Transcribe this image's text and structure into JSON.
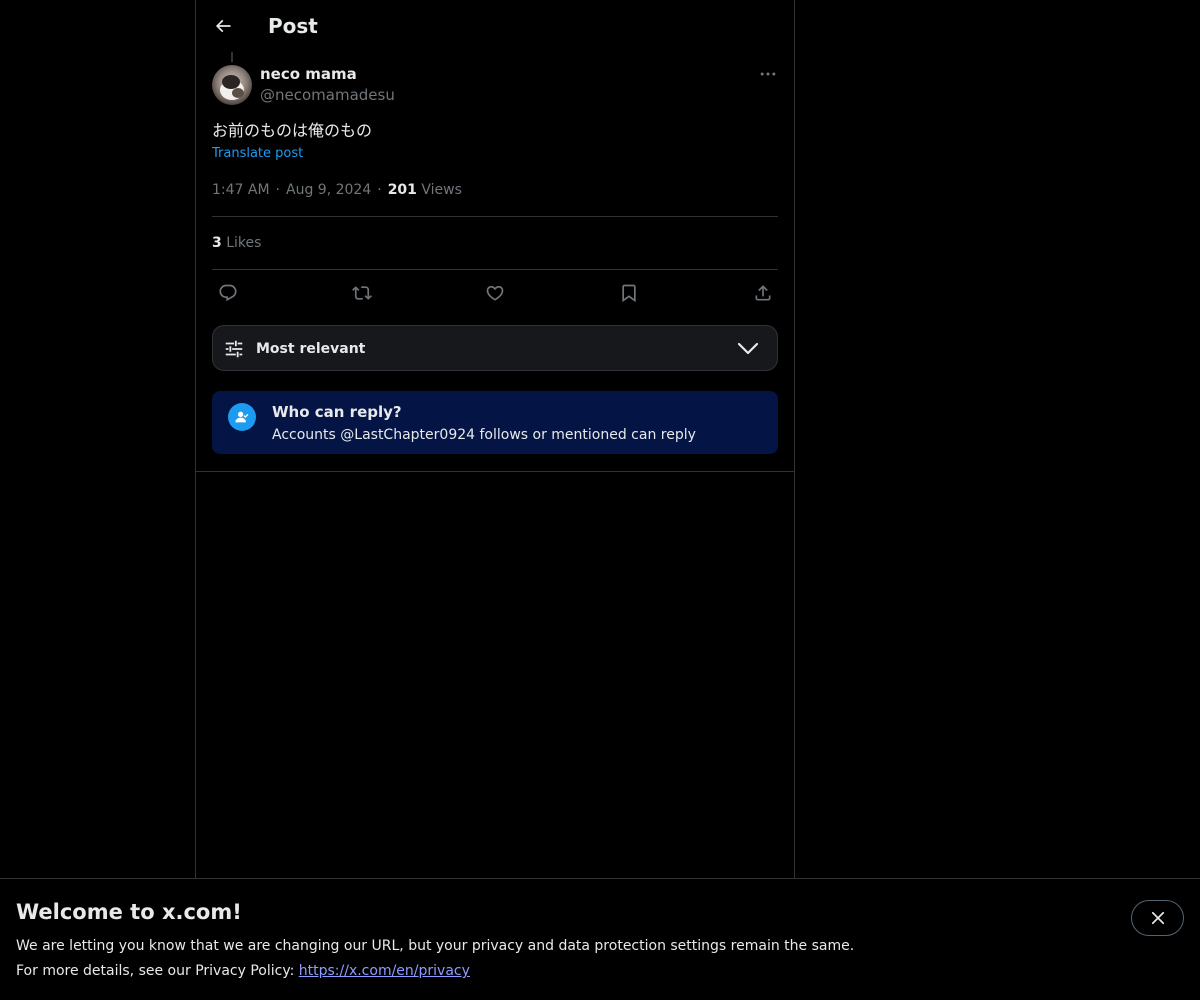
{
  "header": {
    "title": "Post",
    "back_icon": "arrow-left-icon"
  },
  "post": {
    "author_name": "neco mama",
    "author_handle": "@necomamadesu",
    "text": "お前のものは俺のもの",
    "translate_label": "Translate post",
    "time": "1:47 AM",
    "date": "Aug 9, 2024",
    "views_count": "201",
    "views_label": "Views",
    "likes_count": "3",
    "likes_label": "Likes"
  },
  "actions": [
    {
      "name": "reply",
      "icon": "reply-icon"
    },
    {
      "name": "repost",
      "icon": "repost-icon"
    },
    {
      "name": "like",
      "icon": "heart-icon"
    },
    {
      "name": "bookmark",
      "icon": "bookmark-icon"
    },
    {
      "name": "share",
      "icon": "share-icon"
    }
  ],
  "sort": {
    "label": "Most relevant"
  },
  "who_can_reply": {
    "title": "Who can reply?",
    "description": "Accounts @LastChapter0924 follows or mentioned can reply"
  },
  "banner": {
    "title": "Welcome to x.com!",
    "line1": "We are letting you know that we are changing our URL, but your privacy and data protection settings remain the same.",
    "line2_prefix": "For more details, see our Privacy Policy: ",
    "link_text": "https://x.com/en/privacy"
  },
  "colors": {
    "background": "#000000",
    "text": "#e7e9ea",
    "muted": "#71767b",
    "accent": "#1d9bf0",
    "border": "#2f3336",
    "info_box": "#031445"
  }
}
